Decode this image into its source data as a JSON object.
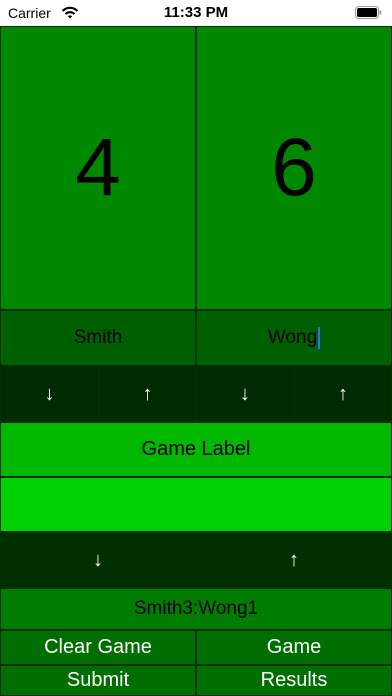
{
  "status_bar": {
    "carrier": "Carrier",
    "time": "11:33 PM",
    "wifi_icon": "wifi-icon",
    "battery_icon": "battery-icon"
  },
  "players": {
    "left": {
      "score": "4",
      "name": "Smith",
      "down_icon": "↓",
      "up_icon": "↑"
    },
    "right": {
      "score": "6",
      "name": "Wong",
      "down_icon": "↓",
      "up_icon": "↑"
    }
  },
  "game": {
    "label": "Game Label",
    "input_value": "",
    "down_icon": "↓",
    "up_icon": "↑",
    "result": "Smith3:Wong1"
  },
  "buttons": {
    "clear_game": "Clear Game",
    "game": "Game",
    "submit": "Submit",
    "results": "Results"
  },
  "colors": {
    "score_bg": "#008800",
    "name_bg": "#005f00",
    "arrow_bg": "#002b00",
    "label_bg": "#00b800",
    "input_bg": "#00d100",
    "result_bg": "#007d00",
    "button_bg": "#006e00",
    "caret": "#2f6cff"
  }
}
